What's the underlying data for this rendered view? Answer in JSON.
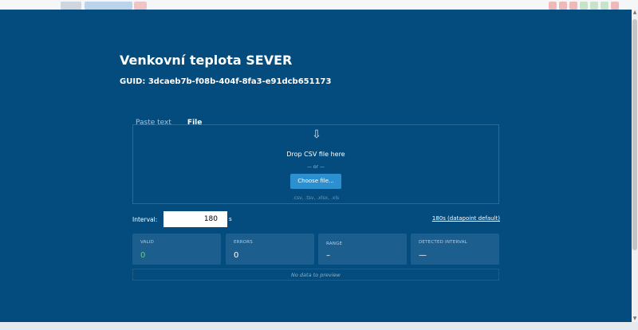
{
  "modal": {
    "title": "Venkovní teplota SEVER",
    "guid": "GUID: 3dcaeb7b-f08b-404f-8fa3-e91dcb651173"
  },
  "tabs": [
    {
      "label": "Paste text",
      "active": false
    },
    {
      "label": "File",
      "active": true
    }
  ],
  "dropzone": {
    "icon": "arrow-down-icon",
    "drop_text": "Drop CSV file here",
    "or_text": "— or —",
    "choose_label": "Choose file...",
    "extensions": ".csv, .tsv, .xlsx, .xls"
  },
  "interval": {
    "label": "Interval:",
    "value": "180",
    "unit": "s",
    "default_link": "180s (datapoint default)"
  },
  "stats": [
    {
      "label": "VALID",
      "value": "0",
      "color": "#5cd16b"
    },
    {
      "label": "ERRORS",
      "value": "0"
    },
    {
      "label": "RANGE",
      "value": "–"
    },
    {
      "label": "DETECTED INTERVAL",
      "value": "—"
    }
  ],
  "preview": {
    "empty_text": "No data to preview"
  }
}
